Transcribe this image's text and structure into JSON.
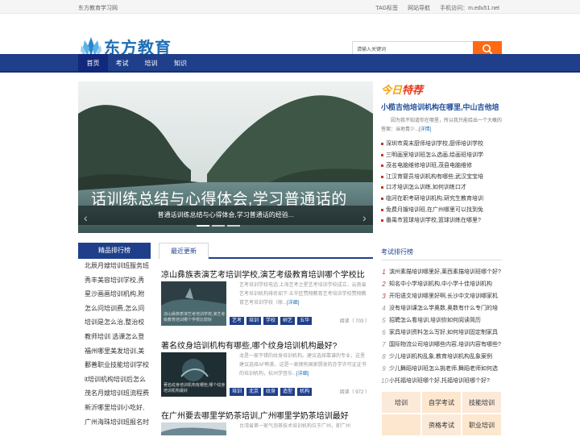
{
  "topbar": {
    "site_name": "东方教育学习网",
    "links": [
      "TAG标签",
      "网站导航",
      "手机访问：m.edu51.net"
    ]
  },
  "logo": {
    "text": "东方教育"
  },
  "search": {
    "placeholder": "请输入关键词"
  },
  "nav": [
    "首页",
    "考试",
    "培训",
    "知识"
  ],
  "banner": {
    "big_text": "话训练总结与心得体会,学习普通话的",
    "caption": "普通话训练总结与心得体会,学习普通话的经验..."
  },
  "today": {
    "label_a": "今日",
    "label_b": "特荐",
    "title": "小榄吉他培训机构在哪里,中山吉他培",
    "summary": "因为我不知道你在哪里，所以我只能给出一个大概的答案：当地青少...",
    "detail": "[详情]",
    "list": [
      "深圳市周末厨师培训学校,厨师培训学校",
      "三明画室培训班怎么选画,绘画班培训学",
      "茂名电脑维修培训班,茂县电脑维修",
      "江汉育婴员培训机构有哪些,武汉宝宝培",
      "口才培训怎么训练,如何训练口才",
      "临河在职考研培训机构,研究生教育培训",
      "免费月嫂培训班,在广州哪里可以找到免",
      "番禺市篮球培训学校,篮球训练在哪里?"
    ]
  },
  "left": {
    "title": "精品排行榜",
    "items": [
      "北辰月嫂培训班服务班",
      "秀丰美容培训学校,秀",
      "星沙画画培训机构,附",
      "怎么问培训费,怎么问",
      "培训是怎么治,整治校",
      "教师培训 选课怎么登",
      "福州哪里美发培训,美",
      "鄱善职业技能培训学校",
      "it培训机构培训后怎么",
      "茂名月嫂培训班流程费",
      "新沂哪里培训小吃好,",
      "广州海珠培训班报名时"
    ]
  },
  "tab": {
    "label": "最近更新"
  },
  "articles": [
    {
      "title": "凉山彝族表演艺考培训学校,演艺考级教育培训哪个学校比",
      "thumb_caption": "凉山彝族表演艺考培训学校,演艺考级教育培训哪个学校比较好",
      "desc": "艺考培训学校电话:上海艺考之星艺考培训学校成立，云南省艺考培训机构排名如下:五华区赞翔教育艺考培训学校赞翔教育艺考培训学校（原...",
      "detail": "[详细]",
      "tags": [
        "艺考",
        "培训",
        "学校",
        "树艺",
        "五华"
      ],
      "views": "阅读（ 703 ）"
    },
    {
      "title": "著名纹身培训机构有哪些,哪个纹身培训机构最好?",
      "thumb_caption": "著名纹身培训机构有哪些,哪个纹身培训机构最好",
      "desc": "龙是一家不错的纹身培训机构。建议选择靠谱的专业，这里建议选择AF韩美，这是一家拥有国家颁发的办学许可证证书的培训机构，杭州学音乐...",
      "detail": "[详细]",
      "tags": [
        "培训",
        "北京",
        "纹身",
        "造型",
        "机构"
      ],
      "views": "阅读（ 972 ）"
    },
    {
      "title": "在广州要去哪里学奶茶培训,广州哪里学奶茶培训最好",
      "desc": "台湾省第一家气泡茶技术培训机构位于广州，即广州"
    }
  ],
  "right": {
    "title": "考试排行榜",
    "items": [
      "滨州素描培训哪里好,莱西素描培训班哪个好?",
      "知名中小学培训机构,中小学十佳培训机构",
      "开阳语文培训哪里好啊,长沙中文培训哪家机",
      "没有培训课怎么学奥数,奥数有什么专门的培",
      "招聘怎么看培训,培训你如何阅读简历",
      "家具培训资料怎么写好,如何培训固定制家具",
      "国际物流公司培训哪些内容,培训内容有哪些?",
      "少儿培训机构乱象,教育培训机构乱象案例",
      "少儿舞蹈培训班怎么挑老师,舞蹈老师如何选",
      "小托福培训班哪个好,托福培训班哪个好?"
    ],
    "grid": [
      "培训",
      "自学考试",
      "技能培训",
      "",
      "资格考试",
      "职业培训"
    ]
  },
  "colors": {
    "nav": "#1f3f8a",
    "accent": "#ff6a13",
    "grid_a": "#fbe9d9",
    "grid_b": "#fde7cf"
  }
}
